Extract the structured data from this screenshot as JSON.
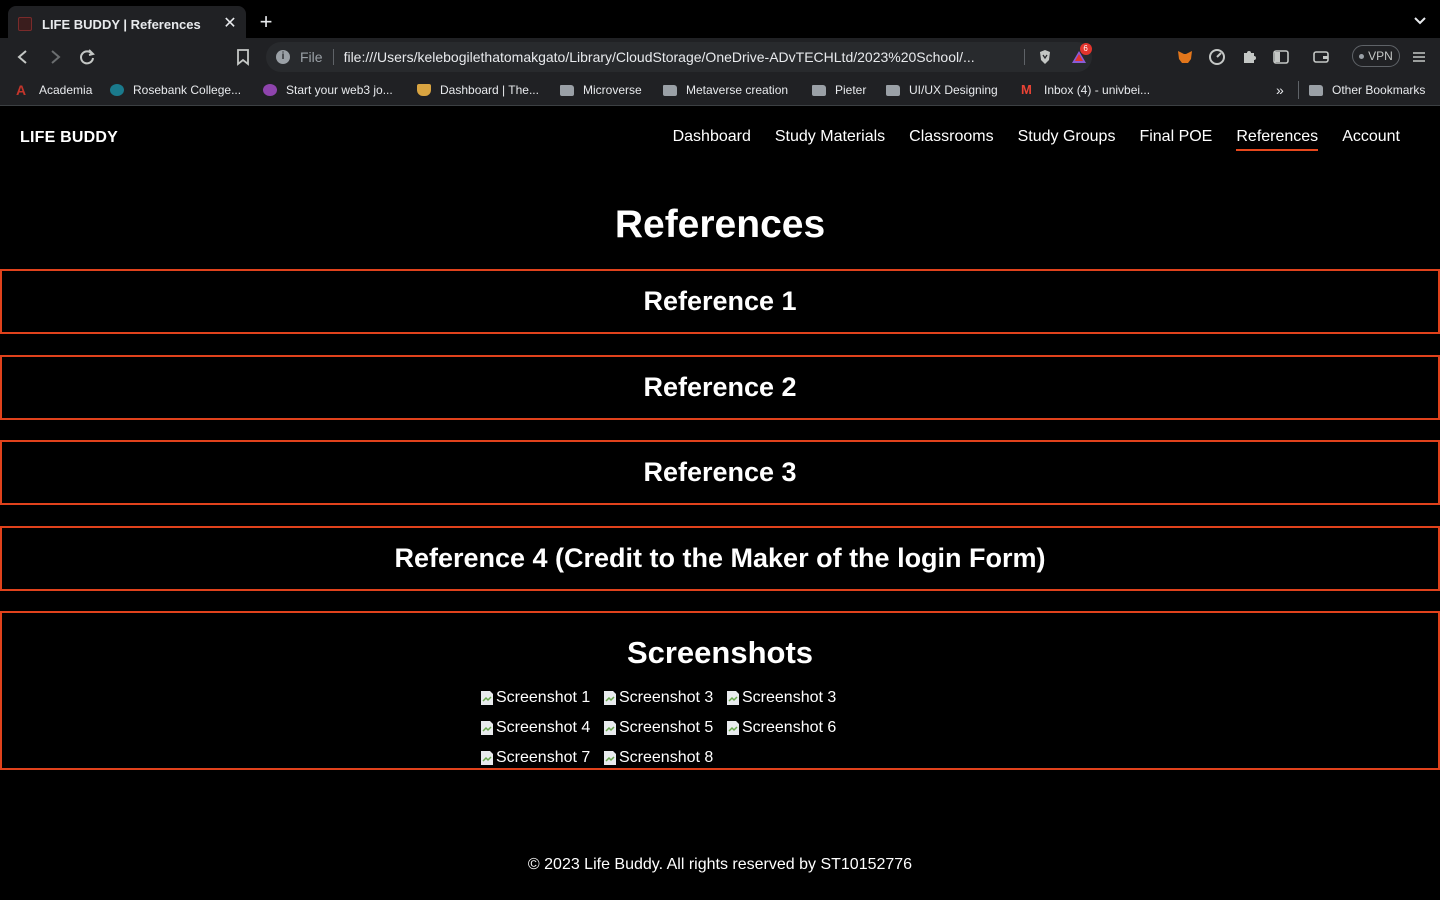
{
  "browser": {
    "tab_title": "LIFE BUDDY | References",
    "scheme_label": "File",
    "url": "file:///Users/kelebogilethatomakgato/Library/CloudStorage/OneDrive-ADvTECHLtd/2023%20School/...",
    "rewards_badge": "6",
    "vpn_label": "VPN",
    "bookmarks": [
      {
        "label": "Academia",
        "icon": "academia-icon",
        "color": "#c3352b"
      },
      {
        "label": "Rosebank College...",
        "icon": "rosebank-icon",
        "color": "#1a7a8c"
      },
      {
        "label": "Start your web3 jo...",
        "icon": "web3-icon",
        "color": "#8e44ad"
      },
      {
        "label": "Dashboard | The...",
        "icon": "dashboard-icon",
        "color": "#d9a441"
      },
      {
        "label": "Microverse",
        "icon": "folder-icon"
      },
      {
        "label": "Metaverse creation",
        "icon": "folder-icon"
      },
      {
        "label": "Pieter",
        "icon": "folder-icon"
      },
      {
        "label": "UI/UX Designing",
        "icon": "folder-icon"
      },
      {
        "label": "Inbox (4) - univbei...",
        "icon": "gmail-icon",
        "color": "#ea4335"
      }
    ],
    "other_bookmarks": "Other Bookmarks",
    "overflow": "»"
  },
  "site": {
    "logo": "LIFE BUDDY",
    "nav": [
      "Dashboard",
      "Study Materials",
      "Classrooms",
      "Study Groups",
      "Final POE",
      "References",
      "Account"
    ],
    "active_nav": "References",
    "accent": "#e0421c"
  },
  "main": {
    "title": "References",
    "references": [
      "Reference 1",
      "Reference 2",
      "Reference 3",
      "Reference 4 (Credit to the Maker of the login Form)"
    ],
    "screenshots_title": "Screenshots",
    "screenshots": [
      "Screenshot 1",
      "Screenshot 3",
      "Screenshot 3",
      "Screenshot 4",
      "Screenshot 5",
      "Screenshot 6",
      "Screenshot 7",
      "Screenshot 8"
    ]
  },
  "footer": {
    "text": "© 2023 Life Buddy. All rights reserved by ST10152776"
  }
}
